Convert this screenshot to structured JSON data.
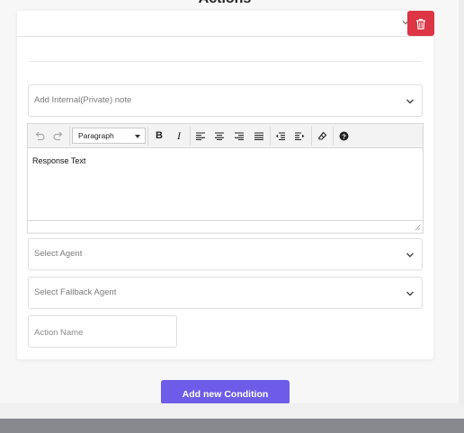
{
  "section": {
    "title": "Actions"
  },
  "card": {
    "internal_note": {
      "label": "Add Internal(Private) note"
    },
    "editor": {
      "format": "Paragraph",
      "content": "Response Text",
      "toolbar_icons": [
        "undo-icon",
        "redo-icon",
        "bold-icon",
        "italic-icon",
        "align-left-icon",
        "align-center-icon",
        "align-right-icon",
        "align-justify-icon",
        "outdent-icon",
        "indent-icon",
        "clear-format-icon",
        "help-icon"
      ]
    },
    "agent_select": {
      "label": "Select Agent"
    },
    "fallback_select": {
      "label": "Select Fallback Agent"
    },
    "action_name": {
      "placeholder": "Action Name"
    }
  },
  "buttons": {
    "add_condition": "Add new Condition"
  },
  "colors": {
    "delete": "#dc3545",
    "primary": "#6c5ce7",
    "bottom_bar": "#88898e"
  }
}
